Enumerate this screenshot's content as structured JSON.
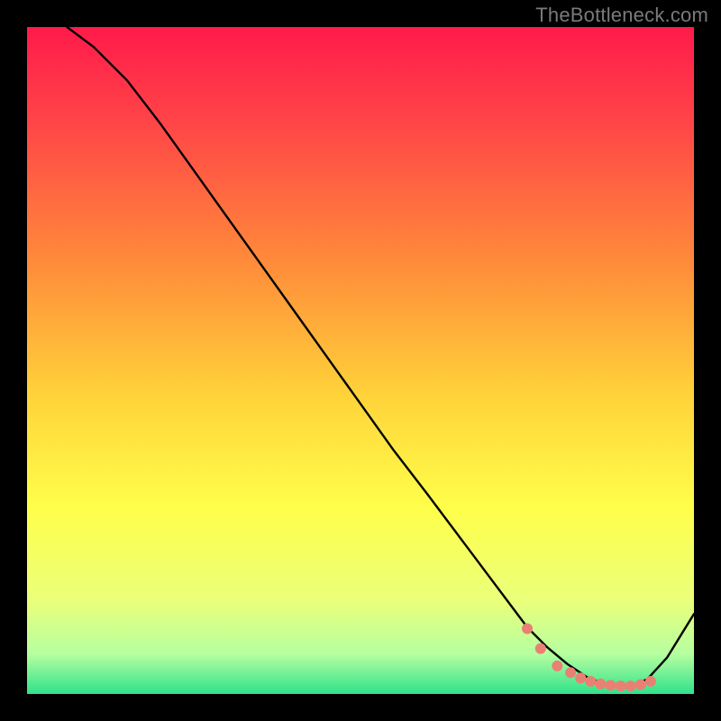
{
  "attribution": "TheBottleneck.com",
  "chart_data": {
    "type": "line",
    "title": "",
    "xlabel": "",
    "ylabel": "",
    "xlim": [
      0,
      100
    ],
    "ylim": [
      0,
      100
    ],
    "grid": false,
    "background_gradient_stops": [
      {
        "offset": 0.0,
        "color": "#ff1a4b"
      },
      {
        "offset": 0.15,
        "color": "#ff4747"
      },
      {
        "offset": 0.35,
        "color": "#ff8a3a"
      },
      {
        "offset": 0.55,
        "color": "#ffd23a"
      },
      {
        "offset": 0.72,
        "color": "#ffff4a"
      },
      {
        "offset": 0.86,
        "color": "#eaff7a"
      },
      {
        "offset": 0.94,
        "color": "#b6ffa0"
      },
      {
        "offset": 1.0,
        "color": "#2fe28b"
      }
    ],
    "series": [
      {
        "name": "curve",
        "color": "#000000",
        "stroke_width": 2.4,
        "x": [
          6,
          10,
          15,
          20,
          25,
          30,
          35,
          40,
          45,
          50,
          55,
          60,
          63,
          66,
          69,
          72,
          75,
          78,
          81,
          84,
          87,
          90,
          93,
          96,
          100
        ],
        "y": [
          100,
          97,
          92,
          85.5,
          78.5,
          71.5,
          64.5,
          57.5,
          50.5,
          43.5,
          36.5,
          30,
          26,
          22,
          18,
          14,
          10,
          7,
          4.5,
          2.5,
          1.3,
          1.0,
          2.2,
          5.5,
          12
        ]
      }
    ],
    "markers": {
      "name": "highlight-dots",
      "color": "#e98074",
      "radius": 6,
      "x": [
        75,
        77,
        79.5,
        81.5,
        83,
        84.5,
        86,
        87.5,
        89,
        90.5,
        92,
        93.5
      ],
      "y": [
        9.8,
        6.8,
        4.2,
        3.2,
        2.4,
        1.9,
        1.5,
        1.3,
        1.2,
        1.2,
        1.4,
        1.9
      ]
    }
  }
}
